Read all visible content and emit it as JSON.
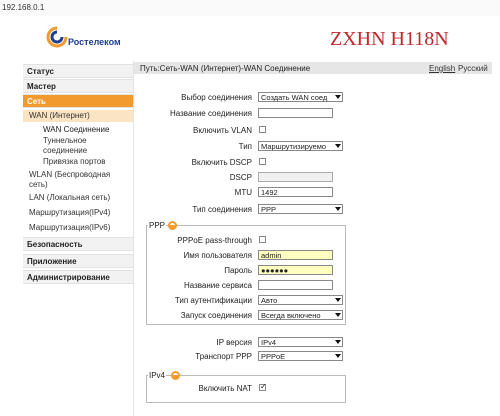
{
  "browser": {
    "address": "192.168.0.1"
  },
  "header": {
    "logo_text": "Ростелеком",
    "model": "ZXHN H118N"
  },
  "sidebar": {
    "items": [
      {
        "label": "Статус"
      },
      {
        "label": "Мастер"
      },
      {
        "label": "Сеть"
      },
      {
        "label": "WAN (Интернет)"
      },
      {
        "label": "WAN Соединение"
      },
      {
        "label": "Туннельное соединение"
      },
      {
        "label": "Привязка портов"
      },
      {
        "label": "WLAN (Беспроводная сеть)"
      },
      {
        "label": "LAN (Локальная сеть)"
      },
      {
        "label": "Маршрутизация(IPv4)"
      },
      {
        "label": "Маршрутизация(IPv6)"
      },
      {
        "label": "Безопасность"
      },
      {
        "label": "Приложение"
      },
      {
        "label": "Администрирование"
      }
    ]
  },
  "path": {
    "text": "Путь:Сеть-WAN (Интернет)-WAN Соединение",
    "lang_en": "English",
    "lang_ru": "Русский"
  },
  "form": {
    "conn_select_label": "Выбор соединения",
    "conn_select_value": "Создать WAN соед",
    "conn_name_label": "Название соединения",
    "conn_name_value": "",
    "vlan_label": "Включить VLAN",
    "type_label": "Тип",
    "type_value": "Маршрутизируемо",
    "dscp_enable_label": "Включить DSCP",
    "dscp_label": "DSCP",
    "dscp_value": "",
    "mtu_label": "MTU",
    "mtu_value": "1492",
    "conn_type_label": "Тип соединения",
    "conn_type_value": "PPP"
  },
  "ppp": {
    "legend": "PPP",
    "passthrough_label": "PPPoE pass-through",
    "username_label": "Имя пользователя",
    "username_value": "admin",
    "password_label": "Пароль",
    "password_value": "●●●●●●",
    "service_label": "Название сервиса",
    "service_value": "",
    "auth_label": "Тип аутентификации",
    "auth_value": "Авто",
    "start_label": "Запуск соединения",
    "start_value": "Всегда включено"
  },
  "ipver": {
    "ip_label": "IP версия",
    "ip_value": "IPv4",
    "transport_label": "Транспорт PPP",
    "transport_value": "PPPoE"
  },
  "ipv4": {
    "legend": "IPv4",
    "nat_label": "Включить NAT"
  },
  "colors": {
    "accent": "#f29a2e",
    "brand_red": "#c0282d",
    "brand_blue": "#1f3f8f"
  }
}
